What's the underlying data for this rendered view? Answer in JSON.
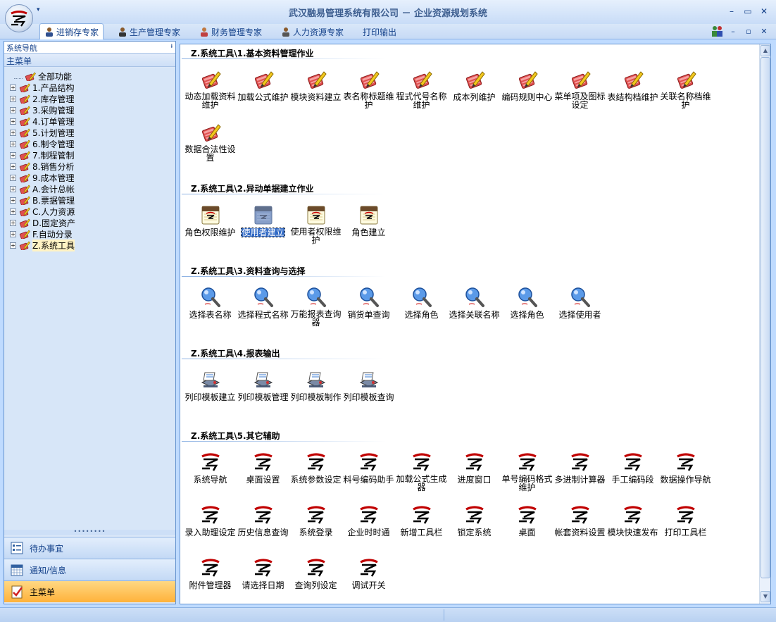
{
  "window": {
    "title": "武汉融易管理系统有限公司 － 企业资源规划系统",
    "quick_access": "▾",
    "minimize": "–",
    "maximize": "▭",
    "close": "✕"
  },
  "ribbon": {
    "tabs": [
      {
        "label": "进销存专家",
        "active": true
      },
      {
        "label": "生产管理专家"
      },
      {
        "label": "财务管理专家"
      },
      {
        "label": "人力资源专家"
      },
      {
        "label": "打印输出"
      }
    ],
    "min": "–",
    "restore": "▫",
    "close": "✕"
  },
  "nav": {
    "header": "系统导航",
    "pin": "ᵼ",
    "menu_title": "主菜单",
    "tree": [
      {
        "label": "全部功能"
      },
      {
        "label": "1.产品结构"
      },
      {
        "label": "2.库存管理"
      },
      {
        "label": "3.采购管理"
      },
      {
        "label": "4.订单管理"
      },
      {
        "label": "5.计划管理"
      },
      {
        "label": "6.制令管理"
      },
      {
        "label": "7.制程管制"
      },
      {
        "label": "8.销售分析"
      },
      {
        "label": "9.成本管理"
      },
      {
        "label": "A.会计总帐"
      },
      {
        "label": "B.票据管理"
      },
      {
        "label": "C.人力资源"
      },
      {
        "label": "D.固定资产"
      },
      {
        "label": "F.自动分录"
      },
      {
        "label": "Z.系统工具"
      }
    ],
    "splitter": "••••••••",
    "panes": [
      {
        "label": "待办事宜"
      },
      {
        "label": "通知/信息"
      },
      {
        "label": "主菜单"
      }
    ]
  },
  "sections": [
    {
      "title": "Z.系统工具\\1.基本资料管理作业",
      "icon": "edit",
      "items": [
        "动态加载资料维护",
        "加载公式维护",
        "模块资料建立",
        "表名称标题维护",
        "程式代号名称维护",
        "成本列维护",
        "编码规则中心",
        "菜单项及图标设定",
        "表结构档维护",
        "关联名称档维护",
        "数据合法性设置"
      ]
    },
    {
      "title": "Z.系统工具\\2.异动单据建立作业",
      "icon": "note",
      "items": [
        "角色权限维护",
        "使用者建立",
        "使用者权限维护",
        "角色建立"
      ]
    },
    {
      "title": "Z.系统工具\\3.资料查询与选择",
      "icon": "search",
      "items": [
        "选择表名称",
        "选择程式名称",
        "万能报表查询器",
        "销货单查询",
        "选择角色",
        "选择关联名称",
        "选择角色",
        "选择使用者"
      ]
    },
    {
      "title": "Z.系统工具\\4.报表输出",
      "icon": "print",
      "items": [
        "列印模板建立",
        "列印模板管理",
        "列印模板制作",
        "列印模板查询"
      ]
    },
    {
      "title": "Z.系统工具\\5.其它辅助",
      "icon": "logo",
      "items": [
        "系统导航",
        "桌面设置",
        "系统参数设定",
        "料号编码助手",
        "加载公式生成器",
        "进度窗口",
        "单号编码格式维护",
        "多进制计算器",
        "手工编码段",
        "数据操作导航",
        "录入助理设定",
        "历史信息查询",
        "系统登录",
        "企业时时通",
        "新增工具栏",
        "锁定系统",
        "桌面",
        "帐套资料设置",
        "模块快速发布",
        "打印工具栏",
        "附件管理器",
        "请选择日期",
        "查询列设定",
        "调试开关"
      ]
    }
  ],
  "scrollbar": {
    "up": "▲",
    "down": "▼"
  }
}
